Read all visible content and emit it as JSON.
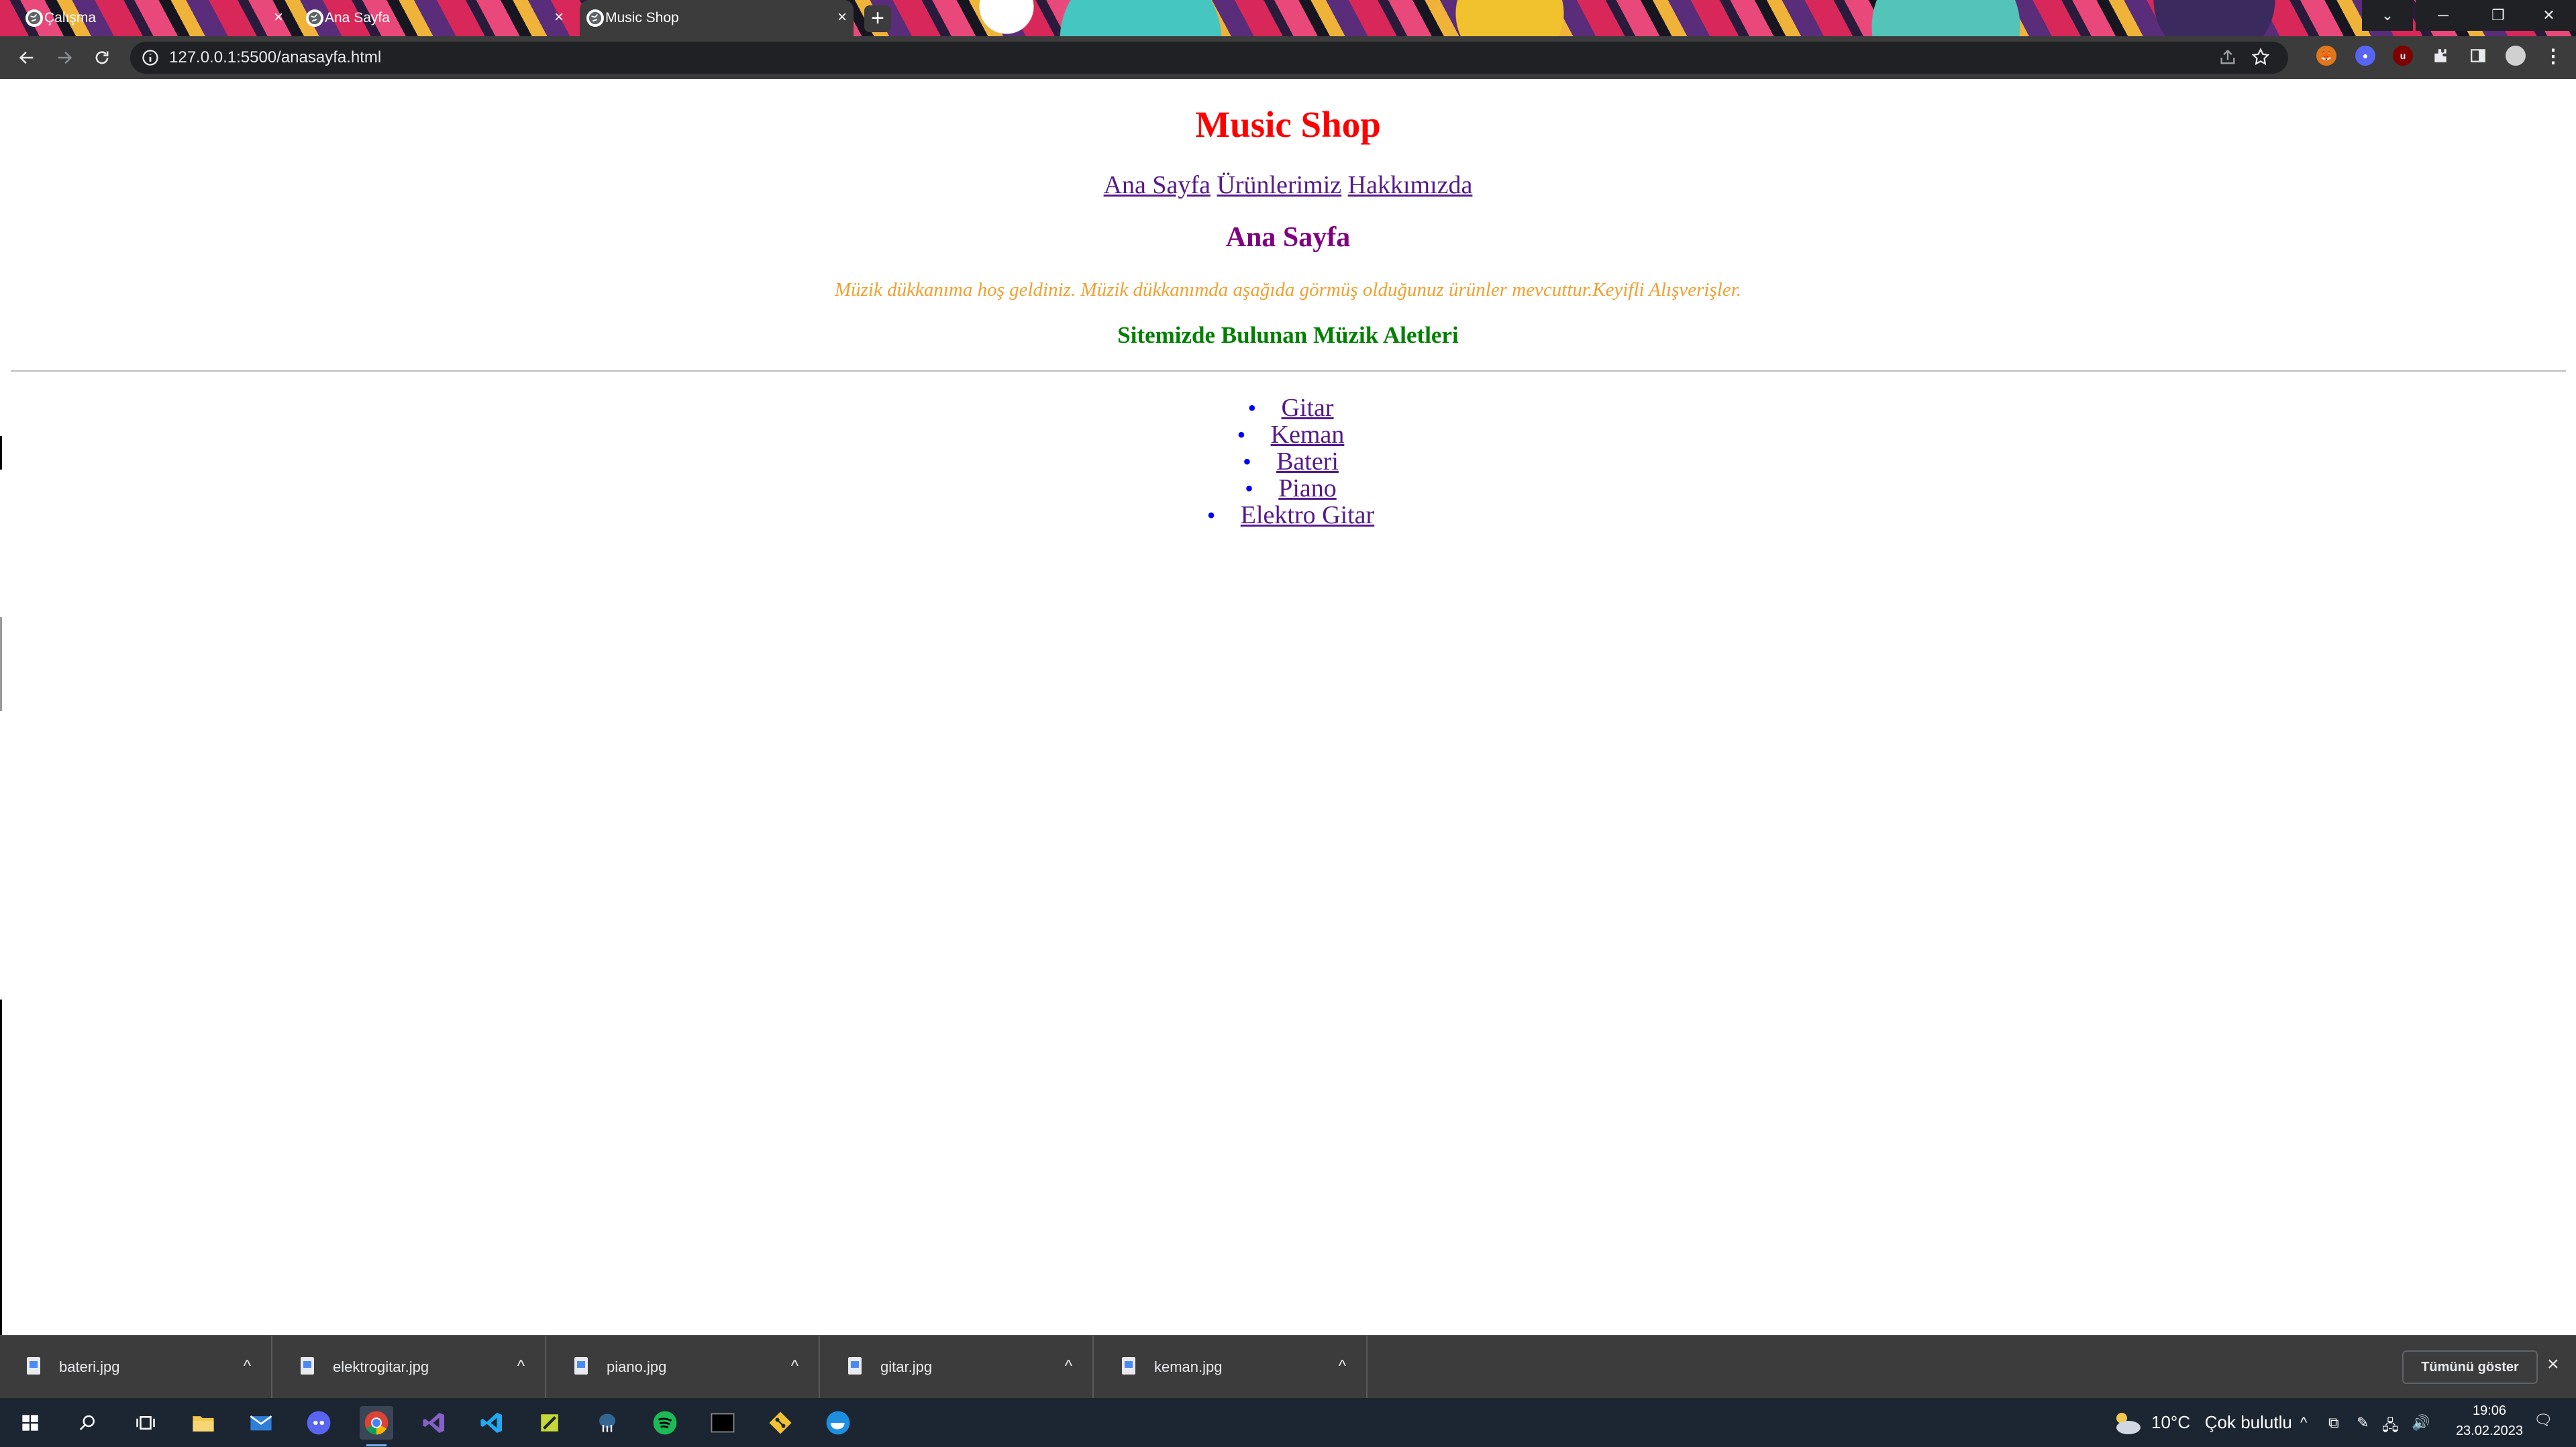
{
  "browser": {
    "tabs": [
      {
        "title": "Çalışma",
        "active": false
      },
      {
        "title": "Ana Sayfa",
        "active": false
      },
      {
        "title": "Music Shop",
        "active": true
      }
    ],
    "new_tab_label": "+",
    "url": "127.0.0.1:5500/anasayfa.html"
  },
  "page": {
    "title": "Music Shop",
    "nav": [
      "Ana Sayfa",
      "Ürünlerimiz",
      "Hakkımızda"
    ],
    "heading": "Ana Sayfa",
    "welcome": "Müzik dükkanıma hoş geldiniz. Müzik dükkanımda aşağıda görmüş olduğunuz ürünler mevcuttur.Keyifli Alışverişler.",
    "section_heading": "Sitemizde Bulunan Müzik Aletleri",
    "instruments": [
      "Gitar",
      "Keman",
      "Bateri",
      "Piano",
      "Elektro Gitar"
    ],
    "colors": {
      "title": "#ff0000",
      "heading": "#800080",
      "welcome": "#f0a030",
      "section": "#008000",
      "link": "#551a8b",
      "bullet": "#0000ff"
    }
  },
  "downloads": {
    "files": [
      "bateri.jpg",
      "elektrogitar.jpg",
      "piano.jpg",
      "gitar.jpg",
      "keman.jpg"
    ],
    "show_all": "Tümünü göster"
  },
  "taskbar": {
    "apps": [
      "windows-start",
      "search",
      "task-view",
      "file-explorer",
      "mail",
      "discord",
      "chrome",
      "visual-studio",
      "vscode",
      "unity-hub",
      "pgadmin",
      "spotify",
      "terminal",
      "git",
      "docker"
    ],
    "weather": {
      "temp": "10°C",
      "condition": "Çok bulutlu"
    },
    "clock": {
      "time": "19:06",
      "date": "23.02.2023"
    }
  }
}
